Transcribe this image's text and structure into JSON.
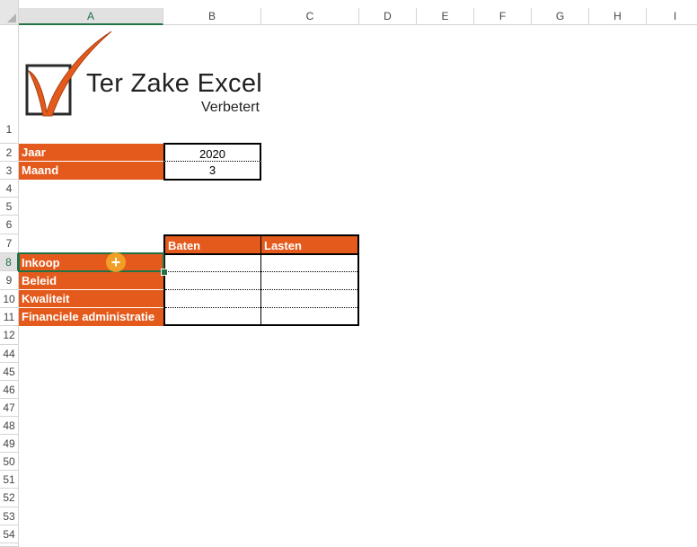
{
  "columns": [
    "A",
    "B",
    "C",
    "D",
    "E",
    "F",
    "G",
    "H",
    "I"
  ],
  "selected_column": "A",
  "rows": [
    "1",
    "2",
    "3",
    "4",
    "5",
    "6",
    "7",
    "8",
    "9",
    "10",
    "11",
    "12",
    "44",
    "45",
    "46",
    "47",
    "48",
    "49",
    "50",
    "51",
    "52",
    "53",
    "54"
  ],
  "selected_row": "8",
  "logo": {
    "title": "Ter Zake Excel",
    "subtitle": "Verbetert"
  },
  "params": [
    {
      "label": "Jaar",
      "value": "2020"
    },
    {
      "label": "Maand",
      "value": "3"
    }
  ],
  "table": {
    "headers": [
      "Baten",
      "Lasten"
    ],
    "rows": [
      "Inkoop",
      "Beleid",
      "Kwaliteit",
      "Financiele administratie"
    ]
  },
  "colors": {
    "accent": "#e35a1c",
    "selection": "#217346",
    "cursor": "#f5aa28"
  }
}
